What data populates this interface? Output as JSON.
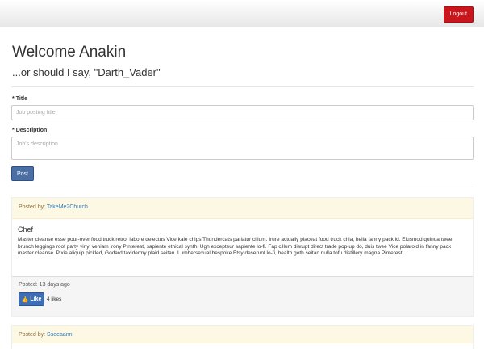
{
  "topbar": {
    "logout_label": "Logout"
  },
  "header": {
    "welcome": "Welcome Anakin",
    "subtitle": "...or should I say, \"Darth_Vader\""
  },
  "form": {
    "required_mark": "*",
    "title_label": "Title",
    "title_placeholder": "Job posting title",
    "description_label": "Description",
    "description_placeholder": "Job's description",
    "post_label": "Post"
  },
  "posts": [
    {
      "posted_by_label": "Posted by:",
      "author": "TakeMe2Church",
      "title": "Chef",
      "description": "Master cleanse esse pour-over food truck retro, labore delectus Vice kale chips Thundercats pariatur cillum. Irure actually placeat food truck chia, hella fanny pack id. Eiusmod quinoa twee brunch leggings roof party vinyl veniam irony Pinterest, sapiente ethical synth. Ugh excepteur sapiente lo-fi. Fap cillum disrupt direct trade pop-up do, duis twee Vice polaroid in fanny pack master cleanse. Pixie aliquip pickled, Godard taxidermy plaid seitan. Lumbersexual bespoke Etsy deserunt lo-fi, health goth seitan nulla tofu distillery magna Pinterest.",
      "posted_time": "Posted: 13 days ago",
      "like_label": "Like",
      "likes": "4 likes"
    },
    {
      "posted_by_label": "Posted by:",
      "author": "Sseeaann"
    }
  ]
}
